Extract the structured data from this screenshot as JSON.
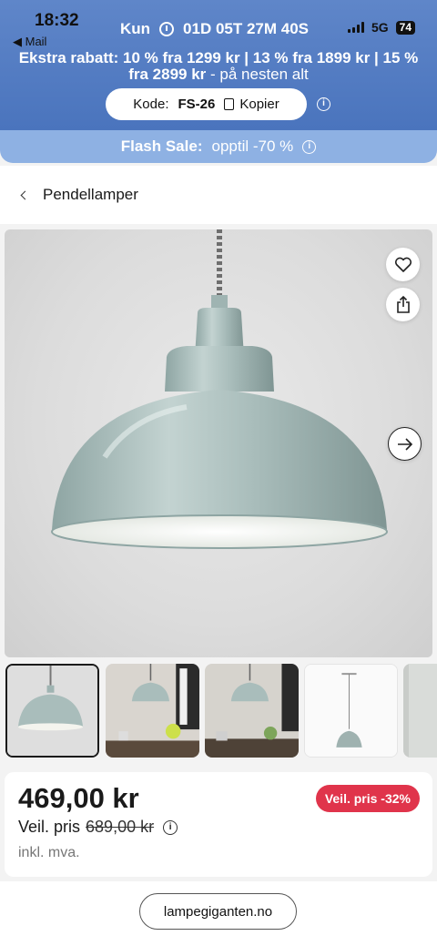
{
  "status_bar": {
    "time": "18:32",
    "back_app": "◀ Mail",
    "network": "5G",
    "battery": "74"
  },
  "promo": {
    "countdown_prefix": "Kun",
    "countdown_value": "01D 05T 27M 40S",
    "text_bold": "Ekstra rabatt: 10 % fra 1299 kr | 13 % fra 1899 kr | 15 % fra 2899 kr",
    "text_rest": " - på nesten alt",
    "code_label": "Kode:",
    "code_value": "FS-26",
    "copy_label": "Kopier",
    "info": "i"
  },
  "flash": {
    "bold": "Flash Sale:",
    "rest": "opptil -70 %",
    "info": "i"
  },
  "breadcrumb": {
    "label": "Pendellamper"
  },
  "product": {
    "price": "469,00 kr",
    "rrp_label": "Veil. pris",
    "rrp_value": "689,00 kr",
    "info": "i",
    "badge": "Veil. pris -32%",
    "vat": "inkl. mva."
  },
  "browser": {
    "url": "lampegiganten.no"
  },
  "icons": [
    "heart-icon",
    "share-icon",
    "arrow-right-icon",
    "chevron-left-icon",
    "timer-icon",
    "copy-icon",
    "info-icon"
  ],
  "colors": {
    "banner": "#4a74bd",
    "flash": "#8eb1e3",
    "badge": "#e0344b",
    "lamp": "#a9bdbb"
  }
}
